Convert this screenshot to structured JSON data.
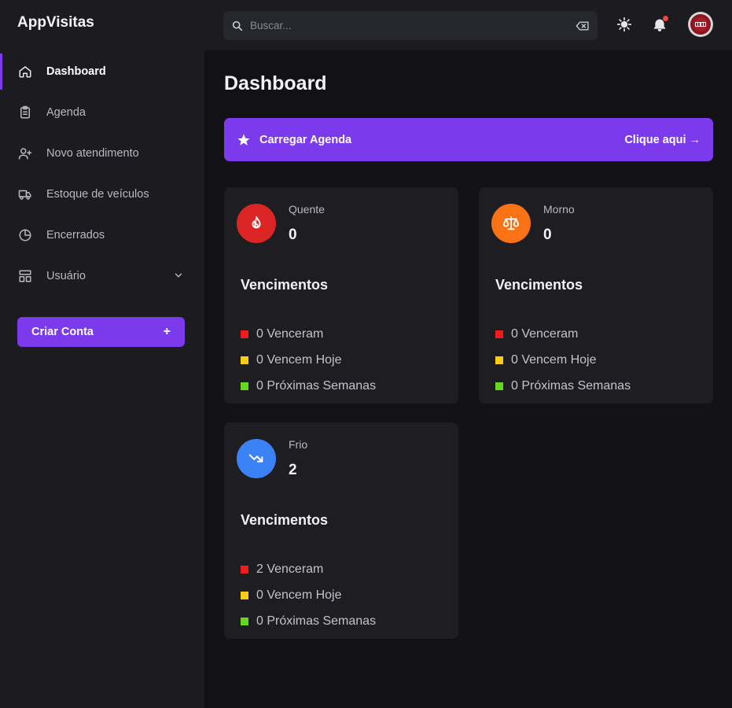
{
  "app": {
    "title": "AppVisitas"
  },
  "sidebar": {
    "items": [
      {
        "label": "Dashboard",
        "icon": "home-icon",
        "active": true
      },
      {
        "label": "Agenda",
        "icon": "clipboard-icon"
      },
      {
        "label": "Novo atendimento",
        "icon": "user-plus-icon"
      },
      {
        "label": "Estoque de veículos",
        "icon": "truck-icon"
      },
      {
        "label": "Encerrados",
        "icon": "pie-chart-icon"
      },
      {
        "label": "Usuário",
        "icon": "layout-icon",
        "has_submenu": true
      }
    ],
    "create_button": {
      "label": "Criar Conta",
      "icon": "+"
    }
  },
  "topbar": {
    "search": {
      "placeholder": "Buscar...",
      "value": ""
    },
    "icons": [
      "search-icon",
      "clear-icon",
      "sun-icon",
      "bell-icon",
      "avatar"
    ],
    "notification_dot": true
  },
  "main": {
    "title": "Dashboard",
    "banner": {
      "text": "Carregar Agenda",
      "link": "Clique aqui →"
    },
    "cards": [
      {
        "label": "Quente",
        "value": "0",
        "icon": "flame-icon",
        "color": "#dc2626",
        "heading": "Vencimentos",
        "stats": [
          {
            "text": "0 Venceram",
            "color": "#ef1c1c"
          },
          {
            "text": "0 Vencem Hoje",
            "color": "#facc15"
          },
          {
            "text": "0 Próximas Semanas",
            "color": "#65d71f"
          }
        ]
      },
      {
        "label": "Morno",
        "value": "0",
        "icon": "scale-icon",
        "color": "#f97316",
        "heading": "Vencimentos",
        "stats": [
          {
            "text": "0 Venceram",
            "color": "#ef1c1c"
          },
          {
            "text": "0 Vencem Hoje",
            "color": "#facc15"
          },
          {
            "text": "0 Próximas Semanas",
            "color": "#65d71f"
          }
        ]
      },
      {
        "label": "Frio",
        "value": "2",
        "icon": "trending-down-icon",
        "color": "#3b82f6",
        "heading": "Vencimentos",
        "stats": [
          {
            "text": "2 Venceram",
            "color": "#ef1c1c"
          },
          {
            "text": "0 Vencem Hoje",
            "color": "#facc15"
          },
          {
            "text": "0 Próximas Semanas",
            "color": "#65d71f"
          }
        ]
      }
    ]
  },
  "colors": {
    "accent": "#7c3aed",
    "background": "#121216",
    "panel": "#1b1b20",
    "card": "#1d1d22"
  }
}
